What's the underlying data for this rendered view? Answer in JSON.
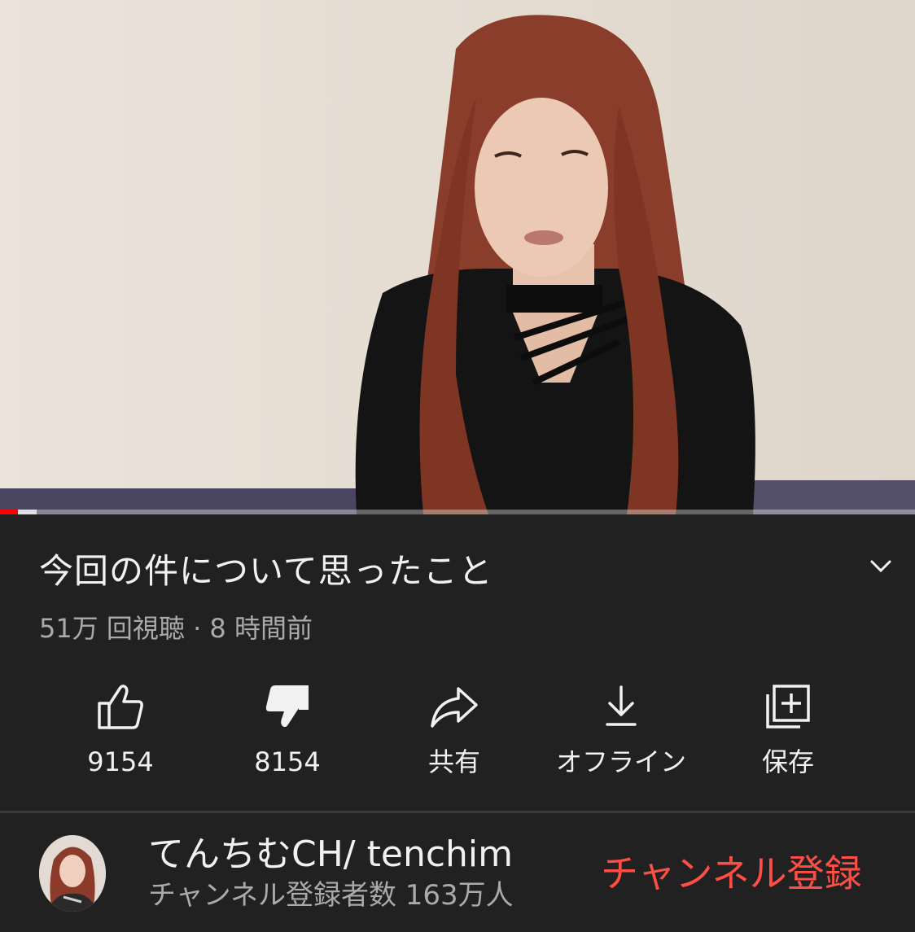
{
  "video": {
    "title": "今回の件について思ったこと",
    "meta": "51万 回視聴 · 8 時間前",
    "progress_played": 0.02,
    "progress_buffered": 0.04
  },
  "actions": [
    {
      "icon": "thumbs-up-icon",
      "label": "9154"
    },
    {
      "icon": "thumbs-down-icon",
      "label": "8154"
    },
    {
      "icon": "share-icon",
      "label": "共有"
    },
    {
      "icon": "download-icon",
      "label": "オフライン"
    },
    {
      "icon": "save-playlist-icon",
      "label": "保存"
    }
  ],
  "channel": {
    "name": "てんちむCH/ tenchim",
    "subscribers": "チャンネル登録者数 163万人",
    "subscribe_label": "チャンネル登録"
  },
  "colors": {
    "background": "#212121",
    "accent_red": "#ff0000",
    "subscribe_text": "#ff4e45",
    "secondary_text": "#aaaaaa"
  }
}
